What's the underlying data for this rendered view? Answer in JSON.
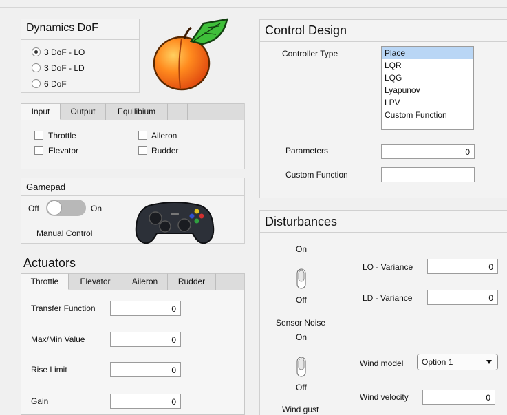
{
  "dynamics": {
    "title": "Dynamics DoF",
    "options": [
      "3 DoF - LO",
      "3 DoF - LD",
      "6 DoF"
    ],
    "selected_index": 0
  },
  "io_tabs": {
    "tabs": [
      "Input",
      "Output",
      "Equilibium"
    ],
    "active": "Input",
    "checks": [
      "Throttle",
      "Aileron",
      "Elevator",
      "Rudder"
    ]
  },
  "gamepad": {
    "title": "Gamepad",
    "off_label": "Off",
    "on_label": "On",
    "manual_label": "Manual Control"
  },
  "actuators": {
    "title": "Actuators",
    "tabs": [
      "Throttle",
      "Elevator",
      "Aileron",
      "Rudder"
    ],
    "active": "Throttle",
    "fields": [
      {
        "label": "Transfer Function",
        "value": "0"
      },
      {
        "label": "Max/Min Value",
        "value": "0"
      },
      {
        "label": "Rise Limit",
        "value": "0"
      },
      {
        "label": "Gain",
        "value": "0"
      }
    ]
  },
  "control": {
    "title": "Control Design",
    "controller_label": "Controller Type",
    "controller_options": [
      "Place",
      "LQR",
      "LQG",
      "Lyapunov",
      "LPV",
      "Custom Function"
    ],
    "selected": "Place",
    "parameters_label": "Parameters",
    "parameters_value": "0",
    "custom_label": "Custom Function",
    "custom_value": ""
  },
  "disturbances": {
    "title": "Disturbances",
    "sensor": {
      "on": "On",
      "off": "Off",
      "name": "Sensor Noise"
    },
    "gust": {
      "on": "On",
      "off": "Off",
      "name": "Wind gust"
    },
    "lo_variance_label": "LO - Variance",
    "lo_variance_value": "0",
    "ld_variance_label": "LD - Variance",
    "ld_variance_value": "0",
    "wind_model_label": "Wind model",
    "wind_model_value": "Option 1",
    "wind_velocity_label": "Wind velocity",
    "wind_velocity_value": "0"
  },
  "colors": {
    "selection": "#b9d6f5",
    "panel": "#f3f3f3"
  }
}
